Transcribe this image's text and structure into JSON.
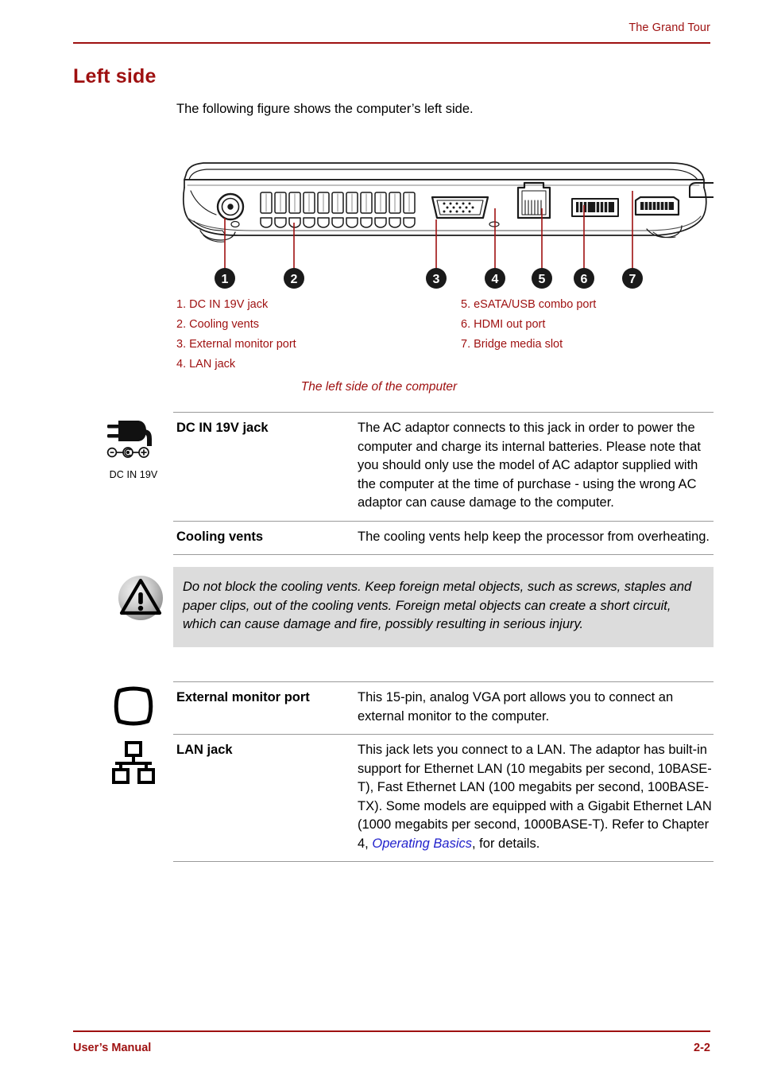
{
  "header": {
    "chapter_title": "The Grand Tour"
  },
  "page_title": "Left side",
  "intro_paragraph": "The following figure shows the computer’s left side.",
  "figure": {
    "caption": "The left side of the computer",
    "callout_numbers": [
      "1",
      "2",
      "3",
      "4",
      "5",
      "6",
      "7"
    ],
    "legend_left": [
      "1. DC IN 19V jack",
      "2. Cooling vents",
      "3. External monitor port",
      "4. LAN jack"
    ],
    "legend_right": [
      "5. eSATA/USB combo port",
      "6. HDMI out port",
      "7. Bridge media slot"
    ]
  },
  "definitions": [
    {
      "icon": "dc-in-plug-icon",
      "icon_label": "DC IN 19V",
      "term": "DC IN 19V jack",
      "description": "The AC adaptor connects to this jack in order to power the computer and charge its internal batteries. Please note that you should only use the model of AC adaptor supplied with the computer at the time of purchase - using the wrong AC adaptor can cause damage to the computer."
    },
    {
      "icon": "none",
      "icon_label": "",
      "term": "Cooling vents",
      "description": "The cooling vents help keep the processor from overheating."
    },
    {
      "icon": "external-monitor-icon",
      "icon_label": "",
      "term": "External monitor port",
      "description": "This 15-pin, analog VGA port allows you to connect an external monitor to the computer."
    },
    {
      "icon": "lan-network-icon",
      "icon_label": "",
      "term": "LAN jack",
      "description_part1": "This jack lets you connect to a LAN. The adaptor has built-in support for Ethernet LAN (10 megabits per second, 10BASE-T), Fast Ethernet LAN (100 megabits per second, 100BASE-TX). Some models are equipped with a Gigabit Ethernet LAN (1000 megabits per second, 1000BASE-T). Refer to Chapter 4, ",
      "description_link": "Operating Basics",
      "description_part2": ", for details."
    }
  ],
  "caution": {
    "icon": "warning-triangle-icon",
    "text": "Do not block the cooling vents. Keep foreign metal objects, such as screws, staples and paper clips, out of the cooling vents. Foreign metal objects can create a short circuit, which can cause damage and fire, possibly resulting in serious injury."
  },
  "footer": {
    "left": "User’s Manual",
    "right": "2-2"
  },
  "colors": {
    "accent_red": "#9E1010",
    "link_blue": "#2222CC",
    "caution_bg": "#DCDCDC",
    "rule_gray": "#9A9A9A"
  }
}
